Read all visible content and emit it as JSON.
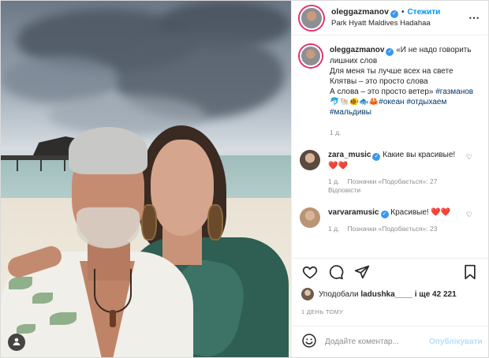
{
  "post": {
    "username": "oleggazmanov",
    "follow_label": "Стежити",
    "location": "Park Hyatt Maldives Hadahaa",
    "caption_lines": [
      "«И не надо говорить",
      "лишних слов",
      "Для меня ты лучше всех на свете",
      "Клятвы – это просто слова",
      "А слова – это просто ветер»"
    ],
    "hashtags": [
      "#газманов",
      "#океан",
      "#отдыхаем",
      "#мальдивы"
    ],
    "emoji_line": "🐬🐚🐠🐟🦀",
    "caption_time": "1 д."
  },
  "comments": [
    {
      "username": "zara_music",
      "text": "Какие вы красивые!",
      "hearts": "❤️❤️",
      "time": "1 д.",
      "likes": "Позначки «Подобається»: 27",
      "reply": "Відповісти"
    },
    {
      "username": "varvaramusic",
      "text": "Красивые! ❤️❤️",
      "time": "1 д.",
      "likes": "Позначки «Подобається»: 23"
    }
  ],
  "likes_bar": {
    "prefix": "Уподобали",
    "user": "ladushka____",
    "suffix": "і ще 42 221"
  },
  "timestamp": "1 ДЕНЬ ТОМУ",
  "add_comment": {
    "placeholder": "Додайте коментар...",
    "publish_label": "Опублікувати"
  },
  "colors": {
    "link_blue": "#0095f6",
    "verified_blue": "#3897f0",
    "hashtag": "#00376b",
    "heart_red": "#e0245e",
    "muted": "#8e8e8e"
  }
}
